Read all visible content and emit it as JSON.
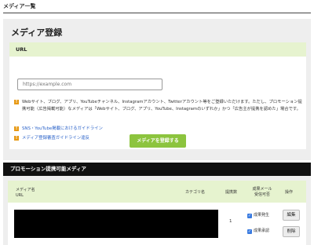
{
  "page": {
    "title": "メディア一覧"
  },
  "register": {
    "heading": "メディア登録",
    "card_label": "URL",
    "url_placeholder": "https://example.com",
    "note": "Webサイト、ブログ、アプリ、YouTubeチャンネル、Instagramアカウント、Twitterアカウント等をご登録いただけます。ただし、プロモーション提携可能（広告掲載可能）なメディアは「Webサイト、ブログ、アプリ、YouTube、Instagramのいずれか」かつ「広告主が提携を認めた」場合です。",
    "links": [
      "SNS・YouTube掲載におけるガイドライン",
      "メディア登録審査ガイドライン違反"
    ],
    "submit_label": "メディアを登録する"
  },
  "promo": {
    "heading": "プロモーション提携可能メディア",
    "columns": {
      "name": "メディア名",
      "url": "URL",
      "category": "カテゴリ名",
      "clicks": "提携数",
      "mail_line1": "成果メール",
      "mail_line2": "受信可否",
      "ops": "操作"
    },
    "rows": [
      {
        "clicks": "1",
        "checks": [
          "成果発生",
          "成果承認"
        ],
        "edit_label": "編集",
        "delete_label": "削除"
      }
    ]
  },
  "colors": {
    "accent_green": "#8cc43e",
    "header_green": "#e6f3cf",
    "warn_orange": "#e79a16",
    "link_blue": "#2a62c9"
  },
  "icons": {
    "warning": "warning-icon",
    "checkbox": "checkbox-checked-icon"
  }
}
